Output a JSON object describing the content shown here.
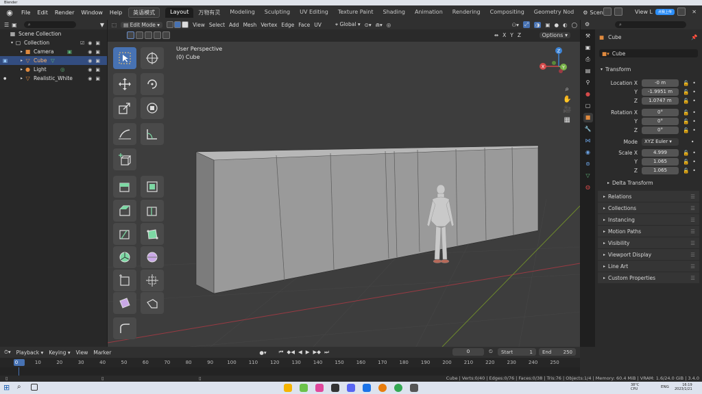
{
  "window": {
    "title": "Blender"
  },
  "menu": [
    "File",
    "Edit",
    "Render",
    "Window",
    "Help"
  ],
  "lang_badge": "英语模式",
  "workspaces": [
    "Layout",
    "万物有灵",
    "Modeling",
    "Sculpting",
    "UV Editing",
    "Texture Paint",
    "Shading",
    "Animation",
    "Rendering",
    "Compositing",
    "Geometry Nod"
  ],
  "active_workspace": "Layout",
  "scene_name": "Scene",
  "view_layer": "View L",
  "upload_label": "点我上传",
  "outliner": {
    "items": [
      {
        "label": "Scene Collection"
      },
      {
        "label": "Collection"
      },
      {
        "label": "Camera"
      },
      {
        "label": "Cube"
      },
      {
        "label": "Light"
      },
      {
        "label": "Realistic_White"
      }
    ]
  },
  "viewport_header": {
    "mode": "Edit Mode",
    "menus": [
      "View",
      "Select",
      "Add",
      "Mesh",
      "Vertex",
      "Edge",
      "Face",
      "UV"
    ],
    "orientation": "Global",
    "options": "Options",
    "axes": [
      "X",
      "Y",
      "Z"
    ]
  },
  "viewport": {
    "perspective": "User Perspective",
    "object_info": "(0) Cube"
  },
  "gizmo": {
    "x": "X",
    "y": "Y",
    "z": "Z"
  },
  "properties": {
    "object_name": "Cube",
    "data_name": "Cube",
    "transform_title": "Transform",
    "location_label": "Location X",
    "location": [
      "-0 m",
      "-1.9951 m",
      "1.0747 m"
    ],
    "rotation_label": "Rotation X",
    "rotation": [
      "0°",
      "0°",
      "0°"
    ],
    "mode_label": "Mode",
    "mode_value": "XYZ Euler",
    "scale_label": "Scale X",
    "scale": [
      "4.999",
      "1.065",
      "1.065"
    ],
    "axis_y": "Y",
    "axis_z": "Z",
    "delta": "Delta Transform",
    "panels": [
      "Relations",
      "Collections",
      "Instancing",
      "Motion Paths",
      "Visibility",
      "Viewport Display",
      "Line Art",
      "Custom Properties"
    ]
  },
  "timeline": {
    "menus": [
      "Playback",
      "Keying",
      "View",
      "Marker"
    ],
    "current_frame": "0",
    "start_label": "Start",
    "start": "1",
    "end_label": "End",
    "end": "250",
    "ticks": [
      "0",
      "10",
      "20",
      "30",
      "40",
      "50",
      "60",
      "70",
      "80",
      "90",
      "100",
      "110",
      "120",
      "130",
      "140",
      "150",
      "160",
      "170",
      "180",
      "190",
      "200",
      "210",
      "220",
      "230",
      "240",
      "250"
    ]
  },
  "statusbar": {
    "text": "Cube | Verts:0/40 | Edges:0/76 | Faces:0/38 | Tris:76 | Objects:1/4 | Memory: 60.4 MiB | VRAM: 1.6/24.0 GiB | 3.4.0"
  },
  "taskbar": {
    "temp": "38°C",
    "cpu": "CPU",
    "lang": "ENG",
    "time": "16:19",
    "date": "2023/1/21"
  },
  "colors": {
    "accent": "#4772b3",
    "selected_row": "#334d80",
    "header": "#303030",
    "viewport": "#3d3d3d"
  }
}
